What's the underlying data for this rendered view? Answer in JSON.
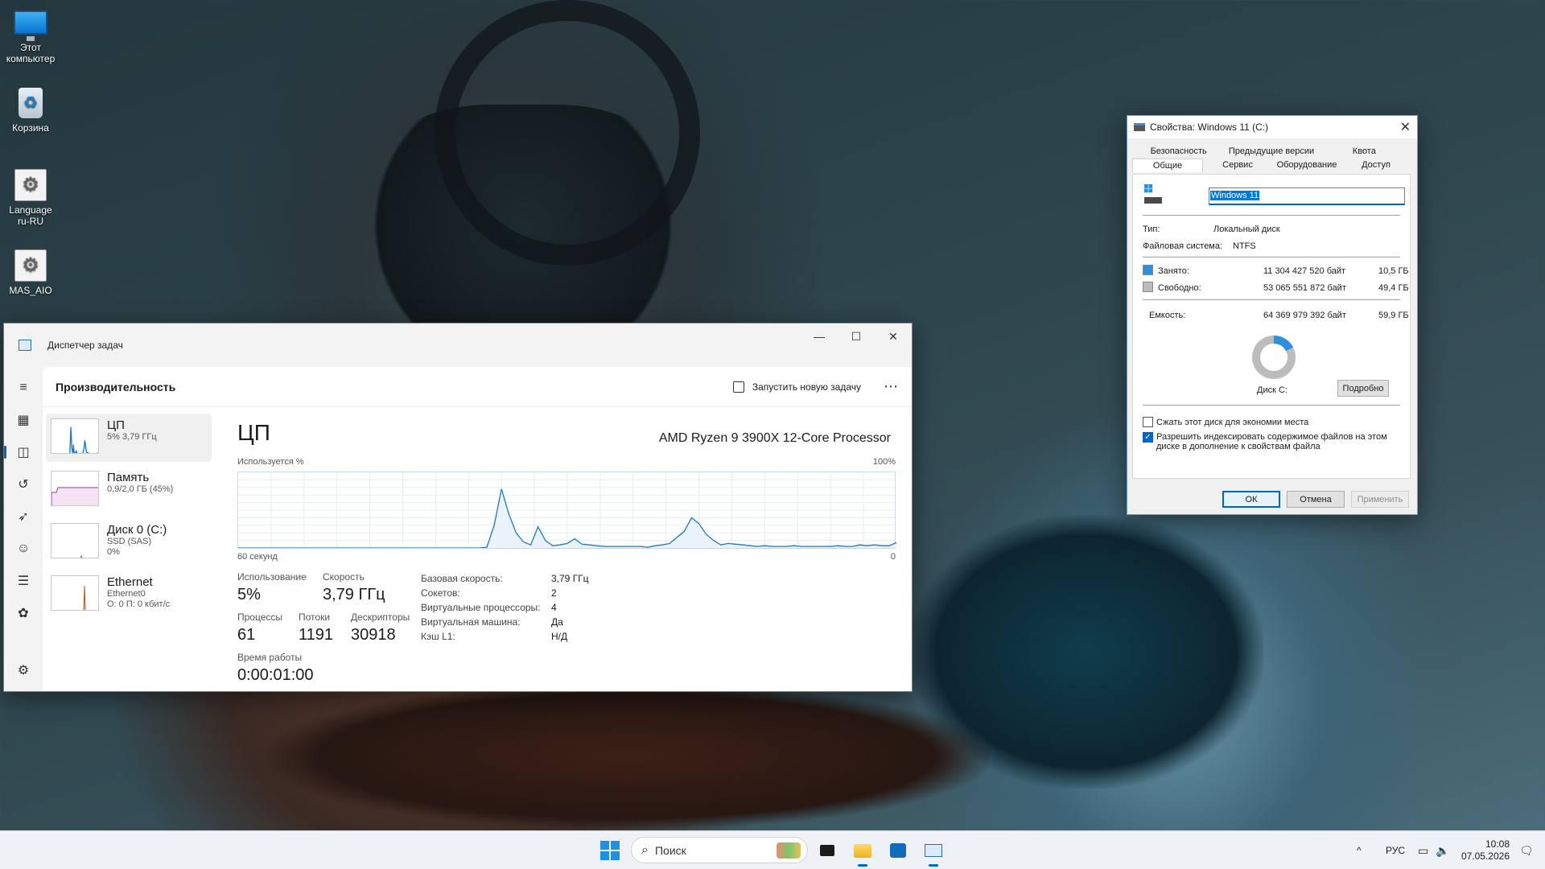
{
  "desktop": {
    "icons": [
      {
        "label": "Этот компьютер",
        "icon": "this-pc-icon"
      },
      {
        "label": "Корзина",
        "icon": "recycle-bin-icon"
      },
      {
        "label": "Language ru-RU",
        "icon": "settings-file-icon"
      },
      {
        "label": "MAS_AIO",
        "icon": "settings-file-icon"
      }
    ]
  },
  "taskmgr": {
    "title": "Диспетчер задач",
    "page_title": "Производительность",
    "run_new_task": "Запустить новую задачу",
    "resources": [
      {
        "name": "ЦП",
        "sub1": "5% 3,79 ГГц",
        "sub2": ""
      },
      {
        "name": "Память",
        "sub1": "0,9/2,0 ГБ (45%)",
        "sub2": ""
      },
      {
        "name": "Диск 0 (C:)",
        "sub1": "SSD (SAS)",
        "sub2": "0%"
      },
      {
        "name": "Ethernet",
        "sub1": "Ethernet0",
        "sub2": "О: 0 П: 0 кбит/с"
      }
    ],
    "detail": {
      "title": "ЦП",
      "model": "AMD Ryzen 9 3900X 12-Core Processor",
      "usage_axis_label": "Используется %",
      "axis_max": "100%",
      "axis_time": "60 секунд",
      "axis_min": "0",
      "cpu_history": [
        0,
        0,
        0,
        0,
        0,
        0,
        0,
        0,
        0,
        0,
        0,
        0,
        0,
        0,
        0,
        0,
        0,
        0,
        0,
        0,
        0,
        0,
        0,
        0,
        0,
        0,
        0,
        0,
        0,
        0,
        0,
        0,
        0,
        0,
        1,
        30,
        78,
        45,
        20,
        8,
        4,
        28,
        10,
        3,
        4,
        6,
        12,
        5,
        4,
        3,
        2,
        2,
        2,
        2,
        2,
        2,
        1,
        3,
        4,
        6,
        14,
        22,
        40,
        32,
        18,
        10,
        4,
        6,
        5,
        4,
        3,
        2,
        3,
        2,
        2,
        2,
        3,
        2,
        2,
        2,
        2,
        2,
        3,
        2,
        2,
        4,
        3,
        4,
        3,
        3,
        7
      ]
    },
    "stats": {
      "usage_label": "Использование",
      "usage_value": "5%",
      "speed_label": "Скорость",
      "speed_value": "3,79 ГГц",
      "procs_label": "Процессы",
      "procs_value": "61",
      "threads_label": "Потоки",
      "threads_value": "1191",
      "handles_label": "Дескрипторы",
      "handles_value": "30918",
      "uptime_label": "Время работы",
      "uptime_value": "0:00:01:00"
    },
    "specs": [
      {
        "k": "Базовая скорость:",
        "v": "3,79 ГГц"
      },
      {
        "k": "Сокетов:",
        "v": "2"
      },
      {
        "k": "Виртуальные процессоры:",
        "v": "4"
      },
      {
        "k": "Виртуальная машина:",
        "v": "Да"
      },
      {
        "k": "Кэш L1:",
        "v": "Н/Д"
      }
    ]
  },
  "props": {
    "title": "Свойства: Windows 11 (C:)",
    "tabs_row1": [
      "Безопасность",
      "Предыдущие версии",
      "Квота"
    ],
    "tabs_row2": [
      "Общие",
      "Сервис",
      "Оборудование",
      "Доступ"
    ],
    "name_value": "Windows 11",
    "type_label": "Тип:",
    "type_value": "Локальный диск",
    "fs_label": "Файловая система:",
    "fs_value": "NTFS",
    "used_label": "Занято:",
    "used_bytes": "11 304 427 520 байт",
    "used_gb": "10,5 ГБ",
    "free_label": "Свободно:",
    "free_bytes": "53 065 551 872 байт",
    "free_gb": "49,4 ГБ",
    "cap_label": "Емкость:",
    "cap_bytes": "64 369 979 392 байт",
    "cap_gb": "59,9 ГБ",
    "disk_label": "Диск C:",
    "details_btn": "Подробно",
    "compress_label": "Сжать этот диск для экономии места",
    "index_label": "Разрешить индексировать содержимое файлов на этом диске в дополнение к свойствам файла",
    "ok": "ОК",
    "cancel": "Отмена",
    "apply": "Применить",
    "used_color": "#2d8fe0",
    "free_color": "#bcbcbc"
  },
  "taskbar": {
    "search_placeholder": "Поиск",
    "lang": "РУС",
    "time": "10:08",
    "date": "07.05.2026"
  }
}
